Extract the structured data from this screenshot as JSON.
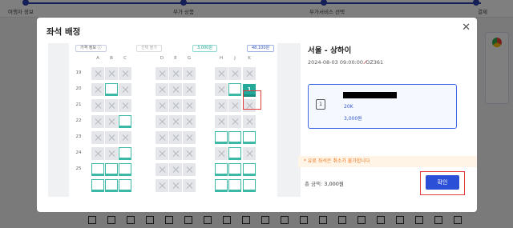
{
  "steps": [
    "여행자 정보",
    "부가 상품",
    "부가서비스 선택",
    "결제"
  ],
  "modal": {
    "title": "좌석 배정",
    "close_icon": "close-icon"
  },
  "legend": {
    "price_info": "가격 정보 ⓘ",
    "unavailable": "선택 불가",
    "green_price": "3,000원",
    "blue_price": "48,100원"
  },
  "seatmap": {
    "columns": [
      "A",
      "B",
      "C",
      "D",
      "E",
      "G",
      "H",
      "J",
      "K"
    ],
    "rows": [
      {
        "row": "19",
        "seats": [
          "x",
          "x",
          "x",
          "x",
          "x",
          "x",
          "x",
          "x",
          "x"
        ]
      },
      {
        "row": "20",
        "seats": [
          "x",
          "a",
          "x",
          "x",
          "x",
          "x",
          "x",
          "a",
          "sel"
        ]
      },
      {
        "row": "21",
        "seats": [
          "x",
          "x",
          "x",
          "x",
          "x",
          "x",
          "x",
          "x",
          "x"
        ]
      },
      {
        "row": "22",
        "seats": [
          "x",
          "x",
          "a",
          "x",
          "x",
          "x",
          "x",
          "x",
          "x"
        ]
      },
      {
        "row": "23",
        "seats": [
          "x",
          "x",
          "x",
          "x",
          "x",
          "x",
          "a",
          "a",
          "a"
        ]
      },
      {
        "row": "24",
        "seats": [
          "x",
          "x",
          "a",
          "x",
          "x",
          "x",
          "x",
          "a",
          "x"
        ]
      },
      {
        "row": "25",
        "seats": [
          "a",
          "a",
          "a",
          "x",
          "x",
          "x",
          "a",
          "a",
          "a"
        ]
      },
      {
        "row": "",
        "seats": [
          "a",
          "a",
          "a",
          "x",
          "x",
          "x",
          "a",
          "a",
          "a"
        ]
      }
    ],
    "selected_label": "1"
  },
  "flight": {
    "route": "서울 - 상하이",
    "datetime": "2024-08-03 09:00:00",
    "flight_no": "OZ361"
  },
  "passenger": {
    "seat": "20K",
    "price": "3,000원"
  },
  "notice": "* 유료 좌석은 취소가 불가합니다",
  "total": {
    "label": "총 금액:",
    "value": "3,000원"
  },
  "confirm_label": "확인",
  "colors": {
    "primary": "#2c4fd8",
    "seat_available": "#3bb8a6",
    "seat_selected": "#23a99a",
    "highlight": "#e23b3b",
    "notice": "#f07a24"
  }
}
